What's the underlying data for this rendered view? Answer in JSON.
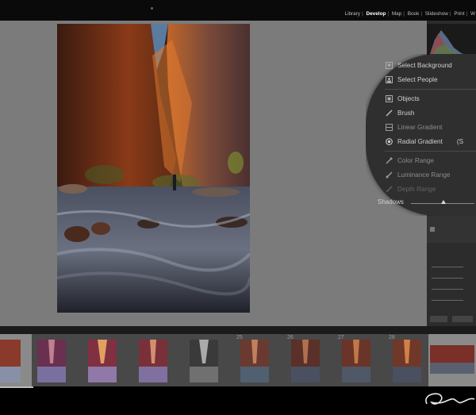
{
  "modules": {
    "items": [
      {
        "label": "Library",
        "active": false
      },
      {
        "label": "Develop",
        "active": true
      },
      {
        "label": "Map",
        "active": false
      },
      {
        "label": "Book",
        "active": false
      },
      {
        "label": "Slideshow",
        "active": false
      },
      {
        "label": "Print",
        "active": false
      },
      {
        "label": "W",
        "active": false
      }
    ],
    "separator": "|"
  },
  "mask_menu": {
    "items": [
      {
        "label": "Select Background",
        "icon": "select-background-icon"
      },
      {
        "label": "Select People",
        "icon": "select-people-icon"
      },
      {
        "label": "Objects",
        "icon": "objects-icon"
      },
      {
        "label": "Brush",
        "icon": "brush-icon"
      },
      {
        "label": "Linear Gradient",
        "icon": "linear-gradient-icon"
      },
      {
        "label": "Radial Gradient",
        "icon": "radial-gradient-icon",
        "shortcut": "(S"
      },
      {
        "label": "Color Range",
        "icon": "color-range-icon"
      },
      {
        "label": "Luminance Range",
        "icon": "luminance-range-icon"
      },
      {
        "label": "Depth Range",
        "icon": "depth-range-icon"
      }
    ]
  },
  "panel": {
    "shadows_label": "Shadows"
  },
  "filmstrip": {
    "numbers": [
      "",
      "",
      "",
      "",
      "",
      "25",
      "26",
      "27",
      "28",
      ""
    ]
  },
  "colors": {
    "workspace": "#7b7b7b",
    "menu_bg": "#2f2f2f",
    "accent_active": "#ffffff"
  }
}
